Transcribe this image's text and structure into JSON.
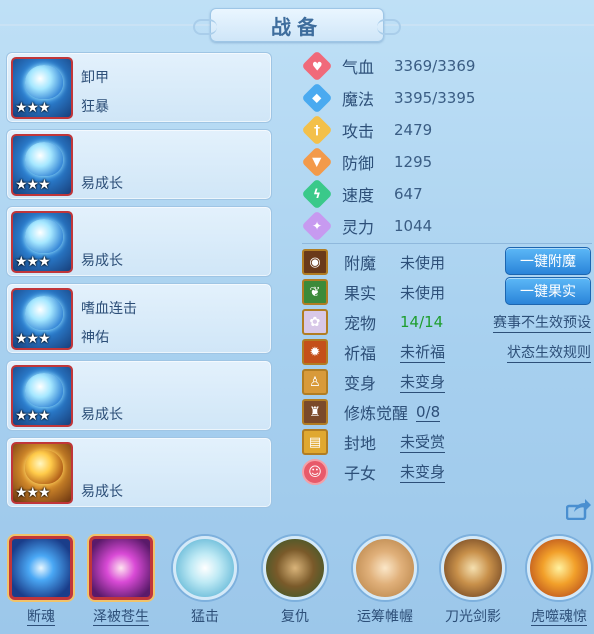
{
  "header": {
    "title": "战备"
  },
  "pets": [
    {
      "line1": "卸甲",
      "line2": "狂暴",
      "stars": "★★★",
      "style": "blue"
    },
    {
      "line1": "",
      "line2": "易成长",
      "stars": "★★★",
      "style": "blue"
    },
    {
      "line1": "",
      "line2": "易成长",
      "stars": "★★★",
      "style": "blue"
    },
    {
      "line1": "嗜血连击",
      "line2": "神佑",
      "stars": "★★★",
      "style": "blue"
    },
    {
      "line1": "",
      "line2": "易成长",
      "stars": "★★★",
      "style": "blue"
    },
    {
      "line1": "",
      "line2": "易成长",
      "stars": "★★★",
      "style": "gold"
    }
  ],
  "stats": [
    {
      "name": "气血",
      "value": "3369/3369",
      "icon": "heart-icon",
      "color": "#f06a7a"
    },
    {
      "name": "魔法",
      "value": "3395/3395",
      "icon": "mana-icon",
      "color": "#4aaaf0"
    },
    {
      "name": "攻击",
      "value": "2479",
      "icon": "sword-icon",
      "color": "#f3c04a"
    },
    {
      "name": "防御",
      "value": "1295",
      "icon": "shield-icon",
      "color": "#f39a4a"
    },
    {
      "name": "速度",
      "value": "647",
      "icon": "speed-icon",
      "color": "#3ac98a"
    },
    {
      "name": "灵力",
      "value": "1044",
      "icon": "spirit-icon",
      "color": "#c79af0"
    }
  ],
  "equip": [
    {
      "name": "附魔",
      "value": "未使用",
      "underline": false,
      "green": false,
      "button": "一键附魔",
      "link": ""
    },
    {
      "name": "果实",
      "value": "未使用",
      "underline": false,
      "green": false,
      "button": "一键果实",
      "link": ""
    },
    {
      "name": "宠物",
      "value": "14/14",
      "underline": false,
      "green": true,
      "button": "",
      "link": "赛事不生效预设"
    },
    {
      "name": "祈福",
      "value": "未祈福",
      "underline": true,
      "green": false,
      "button": "",
      "link": "状态生效规则"
    },
    {
      "name": "变身",
      "value": "未变身",
      "underline": true,
      "green": false,
      "button": "",
      "link": ""
    },
    {
      "name": "修炼觉醒",
      "value": "0/8",
      "underline": true,
      "green": false,
      "button": "",
      "link": ""
    },
    {
      "name": "封地",
      "value": "未受赏",
      "underline": true,
      "green": false,
      "button": "",
      "link": ""
    },
    {
      "name": "子女",
      "value": "未变身",
      "underline": true,
      "green": false,
      "button": "",
      "link": ""
    }
  ],
  "skills": [
    {
      "name": "断魂",
      "shape": "square",
      "underline": true,
      "color": "#2f7fe0"
    },
    {
      "name": "泽被苍生",
      "shape": "square",
      "underline": true,
      "color": "#c63ad0"
    },
    {
      "name": "猛击",
      "shape": "round",
      "underline": false,
      "color": "#8fd3e6"
    },
    {
      "name": "复仇",
      "shape": "round",
      "underline": false,
      "color": "#6f8c3a"
    },
    {
      "name": "运筹帷幄",
      "shape": "round",
      "underline": false,
      "color": "#d9a25e"
    },
    {
      "name": "刀光剑影",
      "shape": "round",
      "underline": false,
      "color": "#b87a3a"
    },
    {
      "name": "虎噬魂惊",
      "shape": "round",
      "underline": true,
      "color": "#e08a1e"
    }
  ]
}
